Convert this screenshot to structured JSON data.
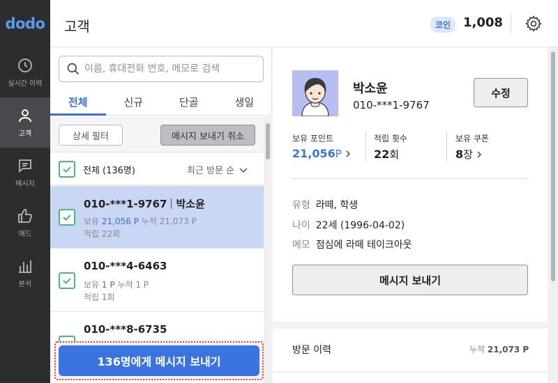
{
  "app": {
    "logo": "dodo"
  },
  "nav": [
    {
      "icon": "clock-icon",
      "label": "실시간 이력",
      "active": false
    },
    {
      "icon": "person-icon",
      "label": "고객",
      "active": true
    },
    {
      "icon": "message-icon",
      "label": "메시지",
      "active": false
    },
    {
      "icon": "thumbs-up-icon",
      "label": "애드",
      "active": false
    },
    {
      "icon": "bar-chart-icon",
      "label": "분석",
      "active": false
    }
  ],
  "header": {
    "title": "고객",
    "coin_label": "코인",
    "coin_value": "1,008"
  },
  "search": {
    "placeholder": "이름, 휴대전화 번호, 메모로 검색"
  },
  "tabs": [
    {
      "label": "전체",
      "active": true
    },
    {
      "label": "신규",
      "active": false
    },
    {
      "label": "단골",
      "active": false
    },
    {
      "label": "생일",
      "active": false
    }
  ],
  "filters": {
    "detail_filter": "상세 필터",
    "cancel_message": "메시지 보내기 취소"
  },
  "list": {
    "select_all_label": "전체 (136명)",
    "sort_label": "최근 방문 순",
    "customers": [
      {
        "phone": "010-***1-9767",
        "name": "박소윤",
        "held_label": "보유",
        "held": "21,056 P",
        "acc_label": "누적",
        "acc": "21,073 P",
        "visits": "적립 22회",
        "selected": true
      },
      {
        "phone": "010-***4-6463",
        "name": "",
        "held_label": "보유",
        "held": "1 P",
        "acc_label": "누적",
        "acc": "1 P",
        "visits": "적립 1회",
        "selected": false
      },
      {
        "phone": "010-***8-6735",
        "name": "",
        "held_label": "",
        "held": "",
        "acc_label": "",
        "acc": "",
        "visits": "",
        "selected": false
      }
    ],
    "send_button": "136명에게 메시지 보내기"
  },
  "detail": {
    "name": "박소윤",
    "phone": "010-***1-9767",
    "edit_button": "수정",
    "stats": [
      {
        "label": "보유 포인트",
        "value": "21,056",
        "unit": "P"
      },
      {
        "label": "적립 횟수",
        "value": "22",
        "unit": "회"
      },
      {
        "label": "보유 쿠폰",
        "value": "8",
        "unit": "장"
      }
    ],
    "info": [
      {
        "key": "유형",
        "value": "라떼, 학생"
      },
      {
        "key": "나이",
        "value": "22세 (1996-04-02)"
      },
      {
        "key": "메모",
        "value": "점심에 라떼 테이크아웃"
      }
    ],
    "message_button": "메시지 보내기"
  },
  "visit": {
    "title": "방문 이력",
    "total_label": "누적",
    "total_value": "21,073 P"
  },
  "colors": {
    "accent": "#3b74e0",
    "check": "#4db87a",
    "sidebar": "#2c2d2f",
    "selected_row": "#c9d7f5",
    "highlight_border": "#d94040"
  }
}
